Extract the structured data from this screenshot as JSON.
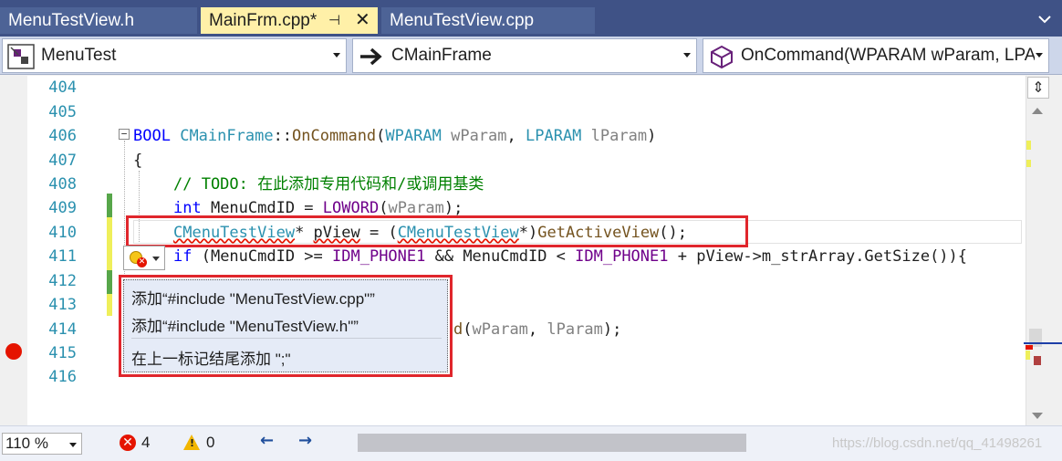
{
  "tabs": [
    {
      "label": "MenuTestView.h"
    },
    {
      "label": "MainFrm.cpp*",
      "pin_glyph": "⊣",
      "close_glyph": "✕"
    },
    {
      "label": "MenuTestView.cpp"
    }
  ],
  "navbar": {
    "project": "MenuTest",
    "class": "CMainFrame",
    "member": "OnCommand(WPARAM wParam, LPARAM lParam)"
  },
  "editor": {
    "line_numbers": [
      "404",
      "405",
      "406",
      "407",
      "408",
      "409",
      "410",
      "411",
      "412",
      "413",
      "414",
      "415",
      "416"
    ],
    "code": {
      "l406": {
        "kw": "BOOL",
        "cls": "CMainFrame",
        "sep": "::",
        "fn": "OnCommand",
        "p1": "(",
        "t1": "WPARAM",
        "sp1": " ",
        "a1": "wParam",
        "c1": ", ",
        "t2": "LPARAM",
        "sp2": " ",
        "a2": "lParam",
        "p2": ")"
      },
      "l407": "{",
      "l408": "// TODO: 在此添加专用代码和/或调用基类",
      "l409": {
        "kw": "int",
        "var": " MenuCmdID = ",
        "mac": "LOWORD",
        "open": "(",
        "arg": "wParam",
        "close": ");"
      },
      "l410": {
        "ty": "CMenuTestView",
        "rest1": "* ",
        "var": "pView",
        "rest2": " = (",
        "ty2": "CMenuTestView",
        "rest3": "*)",
        "fn": "GetActiveView",
        "rest4": "();"
      },
      "l411": {
        "kw": "if",
        "p1": " (MenuCmdID >= ",
        "m1": "IDM_PHONE1",
        "p2": " && MenuCmdID < ",
        "m2": "IDM_PHONE1",
        "p3": " + pView->m_strArray.GetSize()){"
      },
      "l414": {
        "fn": "d",
        "rest1": "(",
        "a1": "wParam",
        "rest2": ", ",
        "a2": "lParam",
        "rest3": ");"
      }
    }
  },
  "quick_actions": {
    "err_glyph": "✕",
    "items": [
      "添加“#include \"MenuTestView.cpp\"”",
      "添加“#include \"MenuTestView.h\"”",
      "在上一标记结尾添加 \";\""
    ]
  },
  "scrollbar": {
    "split_glyph": "⇕"
  },
  "status": {
    "zoom": "110 %",
    "errors": "4",
    "warnings": "0",
    "err_glyph": "✕",
    "warn_glyph": "!",
    "nav_back": "←",
    "nav_forward": "→"
  },
  "watermark": "https://blog.csdn.net/qq_41498261",
  "colors": {
    "accent_red": "#e0262c",
    "tab_bar": "#3f5286",
    "active_tab": "#fff0a8"
  }
}
